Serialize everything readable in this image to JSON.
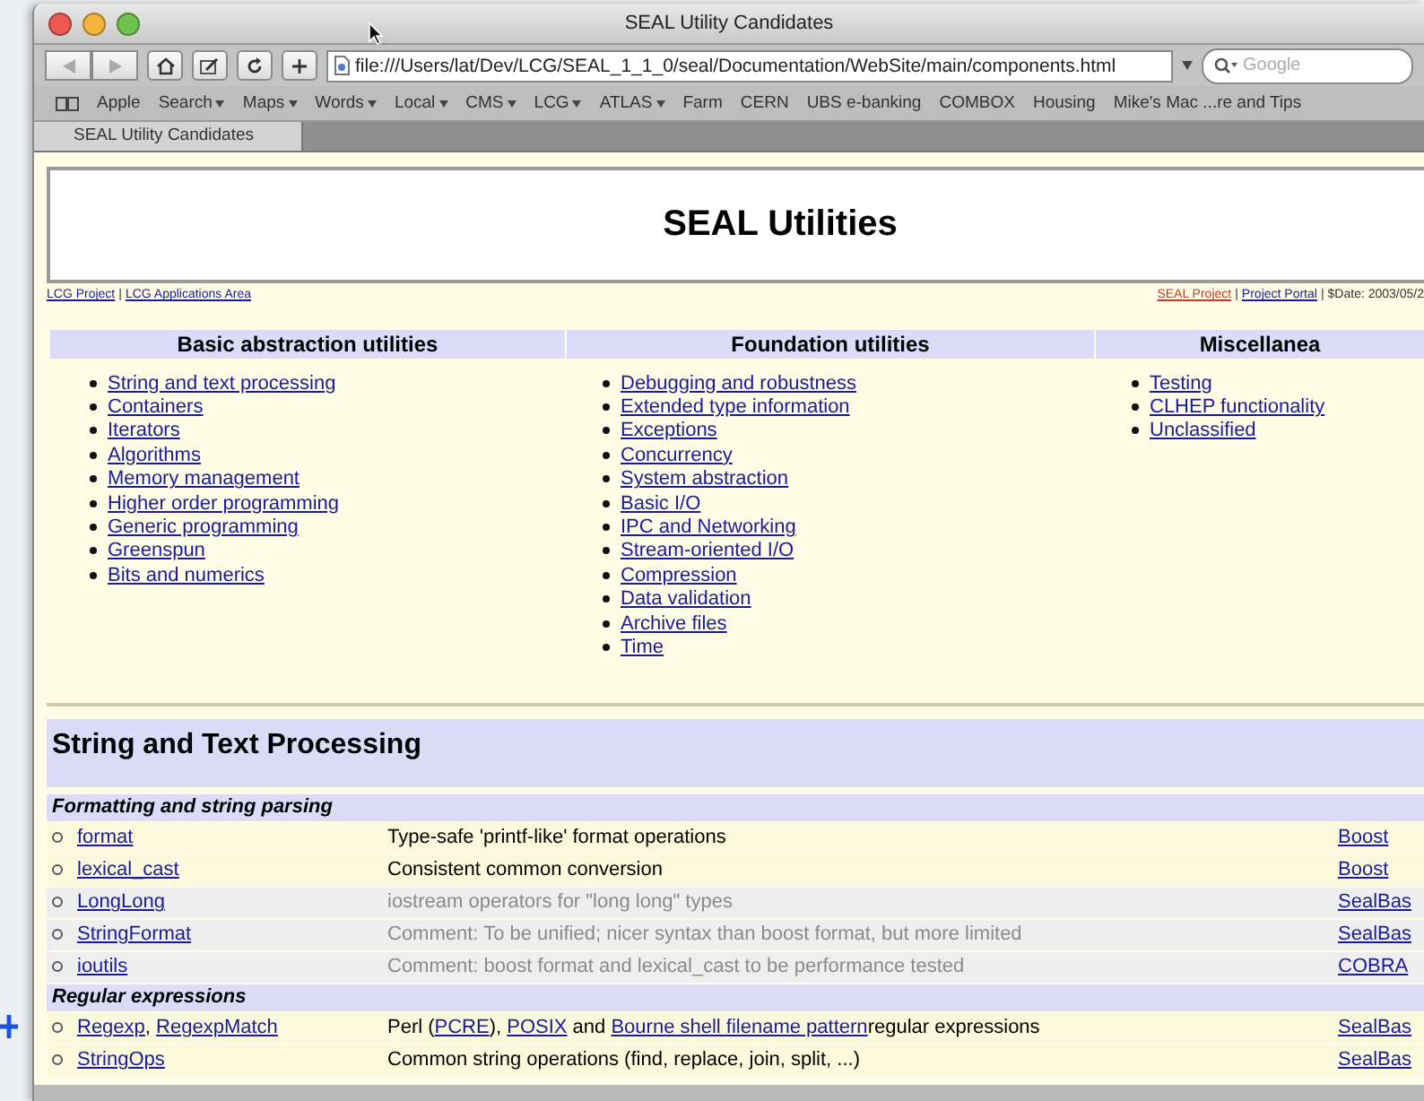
{
  "window": {
    "title": "SEAL Utility Candidates"
  },
  "toolbar": {
    "url_menu": true,
    "url": "file:///Users/lat/Dev/LCG/SEAL_1_1_0/seal/Documentation/WebSite/main/components.html",
    "search": {
      "placeholder": "Google"
    }
  },
  "bookmarks": [
    {
      "label": "Apple",
      "menu": false
    },
    {
      "label": "Search",
      "menu": true
    },
    {
      "label": "Maps",
      "menu": true
    },
    {
      "label": "Words",
      "menu": true
    },
    {
      "label": "Local",
      "menu": true
    },
    {
      "label": "CMS",
      "menu": true
    },
    {
      "label": "LCG",
      "menu": true
    },
    {
      "label": "ATLAS",
      "menu": true
    },
    {
      "label": "Farm",
      "menu": false
    },
    {
      "label": "CERN",
      "menu": false
    },
    {
      "label": "UBS e-banking",
      "menu": false
    },
    {
      "label": "COMBOX",
      "menu": false
    },
    {
      "label": "Housing",
      "menu": false
    },
    {
      "label": "Mike's Mac ...re and Tips",
      "menu": false
    }
  ],
  "tabs": [
    {
      "label": "SEAL Utility Candidates",
      "selected": true
    }
  ],
  "page": {
    "title": "SEAL Utilities",
    "separator": "|",
    "nav_left": [
      {
        "label": "LCG Project",
        "visited": false
      },
      {
        "label": "LCG Applications Area",
        "visited": false
      }
    ],
    "nav_right": [
      {
        "label": "SEAL Project",
        "visited": true
      },
      {
        "label": "Project Portal",
        "visited": false
      }
    ],
    "date": "$Date: 2003/05/2",
    "categories": [
      {
        "heading": "Basic abstraction utilities",
        "links": [
          "String and text processing",
          "Containers",
          "Iterators",
          "Algorithms",
          "Memory management",
          "Higher order programming",
          "Generic programming",
          "Greenspun",
          "Bits and numerics"
        ]
      },
      {
        "heading": "Foundation utilities",
        "links": [
          "Debugging and robustness",
          "Extended type information",
          "Exceptions",
          "Concurrency",
          "System abstraction",
          "Basic I/O",
          "IPC and Networking",
          "Stream-oriented I/O",
          "Compression",
          "Data validation",
          "Archive files",
          "Time"
        ]
      },
      {
        "heading": "Miscellanea",
        "links": [
          "Testing",
          "CLHEP functionality",
          "Unclassified"
        ]
      }
    ],
    "section": {
      "title": "String and Text Processing",
      "groups": [
        {
          "title": "Formatting and string parsing",
          "rows": [
            {
              "names": [
                {
                  "kind": "link",
                  "text": "format"
                }
              ],
              "description": [
                {
                  "kind": "text",
                  "text": "Type-safe 'printf-like' format operations"
                }
              ],
              "source": "Boost",
              "muted": false
            },
            {
              "names": [
                {
                  "kind": "link",
                  "text": "lexical_cast"
                }
              ],
              "description": [
                {
                  "kind": "text",
                  "text": "Consistent common conversion"
                }
              ],
              "source": "Boost",
              "muted": false
            },
            {
              "names": [
                {
                  "kind": "link",
                  "text": "LongLong"
                }
              ],
              "description": [
                {
                  "kind": "text",
                  "text": "iostream operators for \"long long\" types"
                }
              ],
              "source": "SealBas",
              "muted": true
            },
            {
              "names": [
                {
                  "kind": "link",
                  "text": "StringFormat"
                }
              ],
              "description": [
                {
                  "kind": "text",
                  "text": "Comment: To be unified; nicer syntax than boost format, but more limited"
                }
              ],
              "source": "SealBas",
              "muted": true
            },
            {
              "names": [
                {
                  "kind": "link",
                  "text": "ioutils"
                }
              ],
              "description": [
                {
                  "kind": "text",
                  "text": "Comment: boost format and lexical_cast to be performance tested"
                }
              ],
              "source": "COBRA",
              "muted": true
            }
          ]
        },
        {
          "title": "Regular expressions",
          "rows": [
            {
              "names": [
                {
                  "kind": "link",
                  "text": "Regexp"
                },
                {
                  "kind": "text",
                  "text": ", "
                },
                {
                  "kind": "link",
                  "text": "RegexpMatch"
                }
              ],
              "description": [
                {
                  "kind": "text",
                  "text": "Perl ("
                },
                {
                  "kind": "link",
                  "text": "PCRE"
                },
                {
                  "kind": "text",
                  "text": "), "
                },
                {
                  "kind": "link",
                  "text": "POSIX"
                },
                {
                  "kind": "text",
                  "text": " and "
                },
                {
                  "kind": "link",
                  "text": "Bourne shell filename pattern"
                },
                {
                  "kind": "text",
                  "text": "regular expressions"
                }
              ],
              "source": "SealBas",
              "muted": false
            },
            {
              "names": [
                {
                  "kind": "link",
                  "text": "StringOps"
                }
              ],
              "description": [
                {
                  "kind": "text",
                  "text": "Common string operations (find, replace, join, split, ...)"
                }
              ],
              "source": "SealBas",
              "muted": false
            }
          ]
        }
      ]
    }
  }
}
